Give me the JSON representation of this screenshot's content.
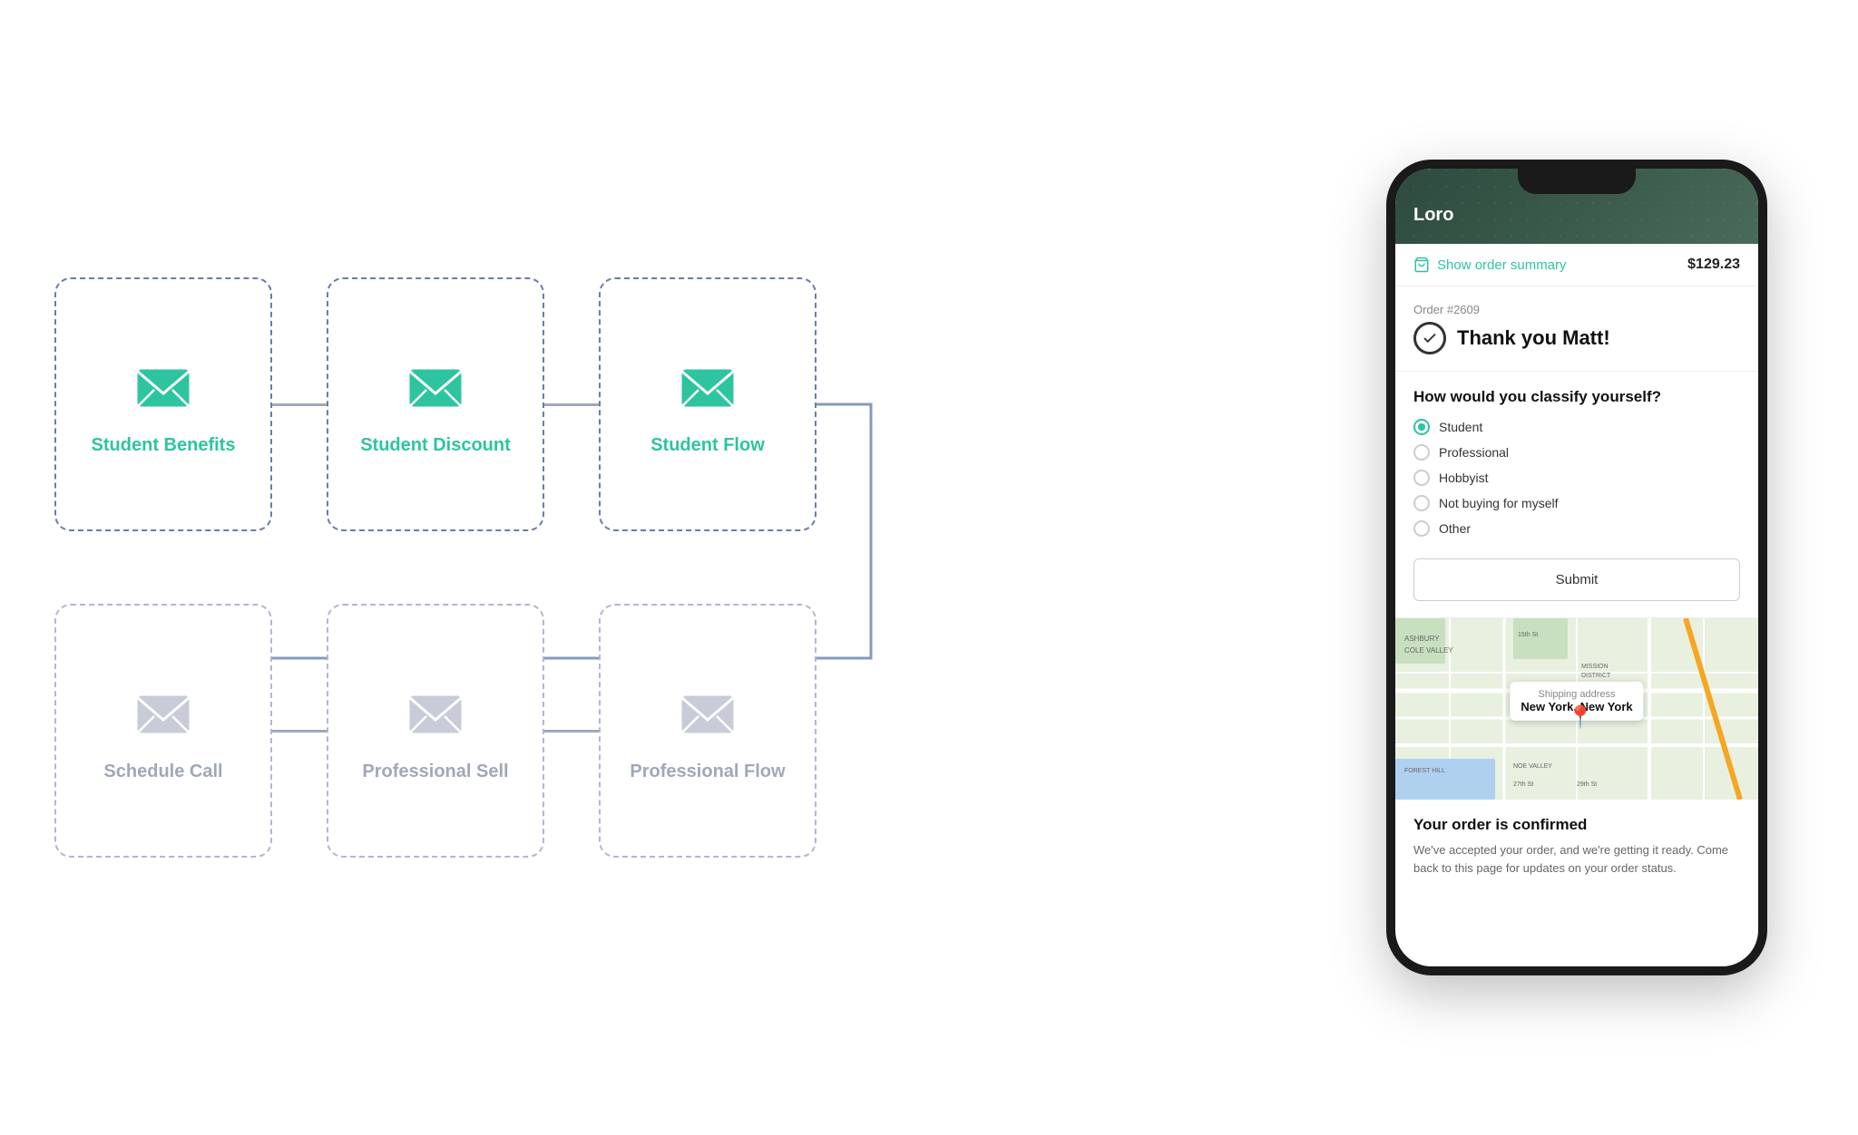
{
  "diagram": {
    "rows": [
      {
        "cards": [
          {
            "id": "student-benefits",
            "label": "Student Benefits",
            "state": "active"
          },
          {
            "id": "student-discount",
            "label": "Student Discount",
            "state": "active"
          },
          {
            "id": "student-flow",
            "label": "Student Flow",
            "state": "active"
          }
        ]
      },
      {
        "cards": [
          {
            "id": "schedule-call",
            "label": "Schedule Call",
            "state": "inactive"
          },
          {
            "id": "professional-sell",
            "label": "Professional Sell",
            "state": "inactive"
          },
          {
            "id": "professional-flow",
            "label": "Professional Flow",
            "state": "inactive"
          }
        ]
      }
    ]
  },
  "phone": {
    "app_name": "Loro",
    "order_summary_label": "Show order summary",
    "order_price": "$129.23",
    "order_number": "Order #2609",
    "thank_you_text": "Thank you Matt!",
    "classify_title": "How would you classify yourself?",
    "options": [
      {
        "label": "Student",
        "selected": true
      },
      {
        "label": "Professional",
        "selected": false
      },
      {
        "label": "Hobbyist",
        "selected": false
      },
      {
        "label": "Not buying for myself",
        "selected": false
      },
      {
        "label": "Other",
        "selected": false
      }
    ],
    "submit_label": "Submit",
    "map_tooltip_label": "Shipping address",
    "map_tooltip_value": "New York, New York",
    "confirmed_title": "Your order is confirmed",
    "confirmed_text": "We've accepted your order, and we're getting it ready. Come back to this page for updates on your order status."
  }
}
